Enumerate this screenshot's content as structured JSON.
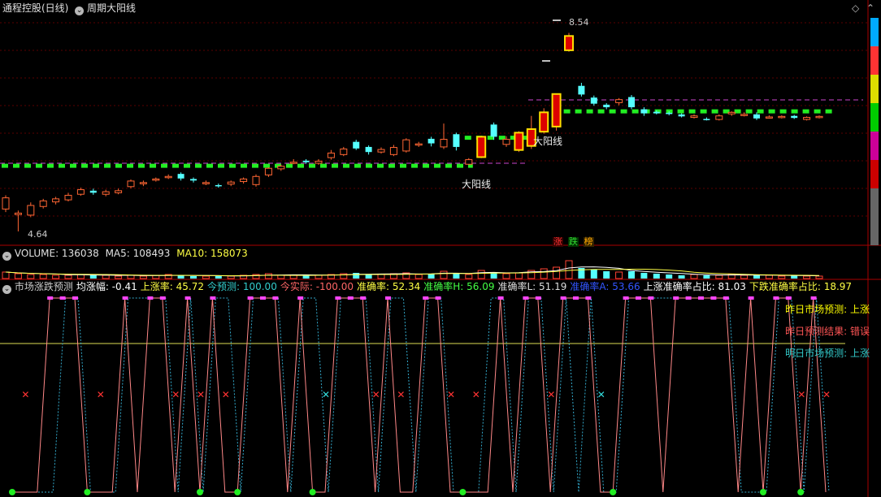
{
  "title_bar": {
    "stock_name": "通程控股(日线)",
    "indicator_name": "周期大阳线"
  },
  "price_panel": {
    "high_label": "8.54",
    "low_label": "4.64",
    "bigyang_label": "大阳线"
  },
  "tags": [
    {
      "text": "涨",
      "color": "#ff3333"
    },
    {
      "text": "跌",
      "color": "#33dd33"
    },
    {
      "text": "榜",
      "color": "#ffaa00"
    }
  ],
  "volume_panel": {
    "label": "VOLUME: 136038",
    "ma5": "MA5: 108493",
    "ma10": "MA10: 158073"
  },
  "forecast_panel": {
    "items": [
      {
        "text": "市场涨跌预测",
        "color": "#cccccc"
      },
      {
        "text": "均涨幅: -0.41",
        "color": "#ffffff"
      },
      {
        "text": "上涨率: 45.72",
        "color": "#ffff44"
      },
      {
        "text": "今预测: 100.00",
        "color": "#33cccc"
      },
      {
        "text": "今实际: -100.00",
        "color": "#ff6666"
      },
      {
        "text": "准确率: 52.34",
        "color": "#ffff44"
      },
      {
        "text": "准确率H: 56.09",
        "color": "#44ff44"
      },
      {
        "text": "准确率L: 51.19",
        "color": "#dddddd"
      },
      {
        "text": "准确率A: 53.66",
        "color": "#3355ff"
      },
      {
        "text": "上涨准确率占比: 81.03",
        "color": "#ffffff"
      },
      {
        "text": "下跌准确率占比: 18.97",
        "color": "#ffff44"
      }
    ],
    "side_notes": [
      {
        "text": "昨日市场预测: 上涨",
        "color": "#ffff00"
      },
      {
        "text": "昨日预测结果: 错误",
        "color": "#ff5555"
      },
      {
        "text": "明日市场预测: 上涨",
        "color": "#33cccc"
      }
    ]
  },
  "chart_data": [
    {
      "type": "candlestick",
      "title": "周期大阳线",
      "candles": [
        [
          5.08,
          5.3,
          5.02,
          5.35
        ],
        [
          4.97,
          5.0,
          4.64,
          5.05
        ],
        [
          4.96,
          5.15,
          4.92,
          5.21
        ],
        [
          5.13,
          5.24,
          5.09,
          5.28
        ],
        [
          5.22,
          5.28,
          5.17,
          5.32
        ],
        [
          5.26,
          5.35,
          5.23,
          5.4
        ],
        [
          5.37,
          5.46,
          5.34,
          5.5
        ],
        [
          5.44,
          5.4,
          5.36,
          5.48
        ],
        [
          5.37,
          5.42,
          5.33,
          5.46
        ],
        [
          5.4,
          5.44,
          5.37,
          5.48
        ],
        [
          5.52,
          5.63,
          5.49,
          5.66
        ],
        [
          5.58,
          5.6,
          5.53,
          5.64
        ],
        [
          5.67,
          5.67,
          5.62,
          5.7
        ],
        [
          5.71,
          5.72,
          5.67,
          5.76
        ],
        [
          5.77,
          5.68,
          5.64,
          5.8
        ],
        [
          5.67,
          5.64,
          5.6,
          5.7
        ],
        [
          5.59,
          5.6,
          5.55,
          5.64
        ],
        [
          5.55,
          5.54,
          5.5,
          5.58
        ],
        [
          5.57,
          5.61,
          5.53,
          5.64
        ],
        [
          5.62,
          5.67,
          5.58,
          5.7
        ],
        [
          5.56,
          5.72,
          5.52,
          5.76
        ],
        [
          5.75,
          5.88,
          5.71,
          5.9
        ],
        [
          5.87,
          5.92,
          5.83,
          5.95
        ],
        [
          5.99,
          6.0,
          5.96,
          6.06
        ],
        [
          6.03,
          6.0,
          5.97,
          6.06
        ],
        [
          5.98,
          6.02,
          5.95,
          6.06
        ],
        [
          6.09,
          6.18,
          6.05,
          6.24
        ],
        [
          6.15,
          6.26,
          6.12,
          6.3
        ],
        [
          6.4,
          6.27,
          6.24,
          6.44
        ],
        [
          6.3,
          6.2,
          6.15,
          6.33
        ],
        [
          6.2,
          6.25,
          6.17,
          6.29
        ],
        [
          6.15,
          6.29,
          6.12,
          6.34
        ],
        [
          6.22,
          6.44,
          6.19,
          6.47
        ],
        [
          6.36,
          6.36,
          6.3,
          6.4
        ],
        [
          6.46,
          6.37,
          6.31,
          6.5
        ],
        [
          6.3,
          6.45,
          6.26,
          6.76
        ],
        [
          6.55,
          6.3,
          6.23,
          6.58
        ],
        [
          5.96,
          6.05,
          5.99,
          6.08
        ],
        [
          6.1,
          6.5,
          6.08,
          6.52
        ],
        [
          6.74,
          6.5,
          6.44,
          6.78
        ],
        [
          6.35,
          6.45,
          6.3,
          6.51
        ],
        [
          6.24,
          6.58,
          6.2,
          6.61
        ],
        [
          6.32,
          6.65,
          6.26,
          6.91
        ],
        [
          6.6,
          6.98,
          6.56,
          7.06
        ],
        [
          6.7,
          7.34,
          6.62,
          7.35
        ],
        [
          8.2,
          8.48,
          8.17,
          8.54
        ],
        [
          7.5,
          7.33,
          7.29,
          7.56
        ],
        [
          7.27,
          7.15,
          7.11,
          7.31
        ],
        [
          7.13,
          7.08,
          7.04,
          7.16
        ],
        [
          7.17,
          7.23,
          7.12,
          7.26
        ],
        [
          7.28,
          7.08,
          7.04,
          7.32
        ],
        [
          7.04,
          6.96,
          6.91,
          7.08
        ],
        [
          6.99,
          6.96,
          6.94,
          7.02
        ],
        [
          6.97,
          6.96,
          6.92,
          7.0
        ],
        [
          6.94,
          6.9,
          6.88,
          6.96
        ],
        [
          6.88,
          6.91,
          6.86,
          6.94
        ],
        [
          6.85,
          6.84,
          6.82,
          6.88
        ],
        [
          6.84,
          6.91,
          6.82,
          6.94
        ],
        [
          6.95,
          6.98,
          6.91,
          7.0
        ],
        [
          6.94,
          6.94,
          6.9,
          6.98
        ],
        [
          6.94,
          6.86,
          6.83,
          6.98
        ],
        [
          6.89,
          6.89,
          6.86,
          6.92
        ],
        [
          6.89,
          6.9,
          6.86,
          6.92
        ],
        [
          6.91,
          6.87,
          6.85,
          6.93
        ],
        [
          6.84,
          6.88,
          6.82,
          6.9
        ],
        [
          6.89,
          6.9,
          6.86,
          6.92
        ]
      ],
      "big_yang_levels": [
        {
          "from": 0,
          "to": 37,
          "value": 5.93
        },
        {
          "from": 37,
          "to": 42,
          "value": 6.48
        },
        {
          "from": 44,
          "to": 66,
          "value": 7.0
        }
      ],
      "ylim": [
        4.4,
        8.9
      ]
    },
    {
      "type": "bar",
      "title": "VOLUME",
      "last": 136038,
      "ma5": 108493,
      "ma10": 158073
    },
    {
      "type": "line",
      "title": "市场涨跌预测",
      "series": [
        {
          "name": "今实际",
          "values": [
            -100,
            -100,
            -100,
            100,
            100,
            100,
            -100,
            -100,
            -100,
            100,
            -100,
            100,
            100,
            -100,
            100,
            -100,
            100,
            -100,
            -100,
            100,
            100,
            100,
            -100,
            100,
            -100,
            -100,
            100,
            100,
            100,
            -100,
            100,
            -100,
            -100,
            100,
            100,
            -100,
            -100,
            -100,
            -100,
            100,
            -100,
            100,
            100,
            -100,
            100,
            100,
            100,
            -100,
            -100,
            100,
            100,
            100,
            -100,
            100,
            100,
            100,
            100,
            100,
            -100,
            100,
            -100,
            100,
            100,
            -100,
            100,
            -100
          ]
        }
      ]
    }
  ]
}
